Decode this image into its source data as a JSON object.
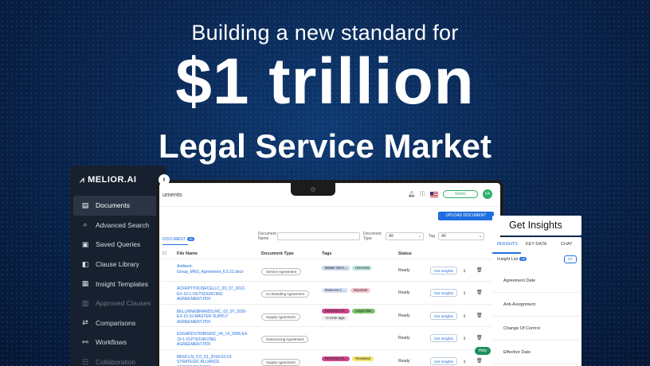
{
  "hero": {
    "subtitle": "Building a new standard for",
    "headline": "$1 trillion",
    "tagline": "Legal Service Market"
  },
  "sidebar": {
    "brand": "MELIOR.AI",
    "items": [
      {
        "label": "Documents",
        "icon": "document-icon",
        "state": "active"
      },
      {
        "label": "Advanced Search",
        "icon": "search-icon",
        "state": "normal"
      },
      {
        "label": "Saved Queries",
        "icon": "bookmark-icon",
        "state": "normal"
      },
      {
        "label": "Clause Library",
        "icon": "book-icon",
        "state": "normal"
      },
      {
        "label": "Insight Templates",
        "icon": "template-icon",
        "state": "normal"
      },
      {
        "label": "Approved Clauses",
        "icon": "check-list-icon",
        "state": "disabled"
      },
      {
        "label": "Comparisons",
        "icon": "compare-icon",
        "state": "normal"
      },
      {
        "label": "Workflows",
        "icon": "workflow-icon",
        "state": "normal"
      },
      {
        "label": "Collaboration",
        "icon": "users-icon",
        "state": "disabled"
      }
    ]
  },
  "app": {
    "page_title": "uments",
    "workspace_select": "Demo",
    "avatar_initials": "FA",
    "upload_button": "UPLOAD DOCUMENT",
    "doc_tab": "DOCUMENT",
    "doc_count": "25",
    "filters": {
      "doc_name_label": "Document Name",
      "doc_type_label": "Document Type",
      "doc_type_value": "All",
      "tag_label": "Tag",
      "tag_value": "All"
    },
    "columns": {
      "file_name": "File Name",
      "document_type": "Document Type",
      "tags": "Tags",
      "status": "Status"
    },
    "rows": [
      {
        "file": "Ambient-Group_MNS_Agreement_6.5.22.docx",
        "type": "Service Agreement",
        "tags": [
          {
            "label": "Master Servi...",
            "color": "#c9d7e8"
          },
          {
            "label": "Universal",
            "color": "#bfe6e0"
          }
        ],
        "status": "Ready",
        "action": "Get Insights"
      },
      {
        "file": "ACFRPTYOUSRCELLC_03_07_2012-EX-10-1-OUTSOURCING AGREEMENT.PDF",
        "type": "Co Branding Agreement",
        "tags": [
          {
            "label": "Business C...",
            "color": "#d9e3f7"
          },
          {
            "label": "Important",
            "color": "#f6c7d2"
          }
        ],
        "status": "Ready",
        "action": "Get Insights"
      },
      {
        "file": "BELLRINGBRANDS,INC_02_07_2020-EX-10.16-MASTER SUPPLY AGREEMENT.PDF",
        "type": "Supply Agreement",
        "tags": [
          {
            "label": "Restricted Cl...",
            "color": "#d0468c"
          },
          {
            "label": "Legal Stan",
            "color": "#7cc36a"
          },
          {
            "label": "+2 more tags",
            "color": "#eeeeee"
          }
        ],
        "status": "Ready",
        "action": "Get Insights"
      },
      {
        "file": "EDGARDSTRIBISINC_04_14_2006-EX-10-1-OUTSOURCING AGREEMENT.PDF",
        "type": "Outsourcing Agreement",
        "tags": [],
        "status": "Ready",
        "action": "Get Insights"
      },
      {
        "file": "MNSCLN_CO_01_2018-03-19-STRATEGIC ALLIANCE AGREEMENT.PDF",
        "type": "Supply Agreement",
        "tags": [
          {
            "label": "Restricted Cl...",
            "color": "#d0468c"
          },
          {
            "label": "Reviewed",
            "color": "#f2e66a"
          }
        ],
        "status": "Ready",
        "action": "Get Insights"
      }
    ],
    "help_label": "Help"
  },
  "insights": {
    "title": "Get Insights",
    "tabs": [
      "INSIGHTS",
      "KEY DATA",
      "CHAT"
    ],
    "list_label": "Insight List",
    "list_count": "25",
    "items": [
      "Agreement Date",
      "Anti-Assignment",
      "Change Of Control",
      "Effective Date"
    ]
  },
  "colors": {
    "background": "#0a2650",
    "sidebar": "#17202e",
    "accent": "#1f6fe0",
    "brand_green": "#2ab06a"
  }
}
